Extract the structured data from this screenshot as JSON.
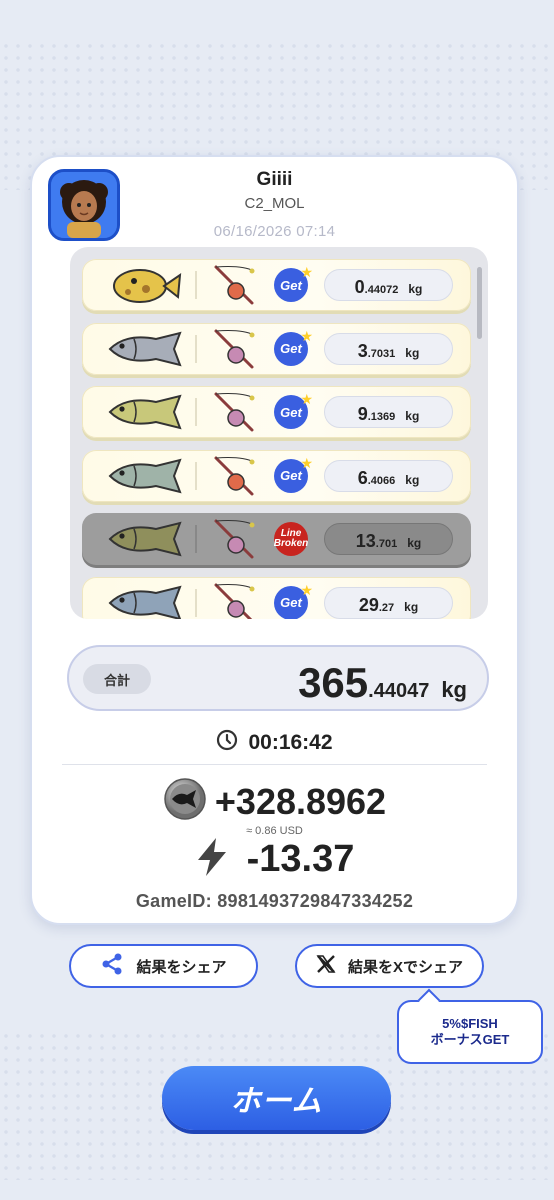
{
  "user": {
    "name": "Giiii",
    "code": "C2_MOL",
    "datetime": "06/16/2026 07:14"
  },
  "catches": [
    {
      "fish": "pufferfish-icon",
      "fish_color": "#e5c34a",
      "rod": "red-rod-icon",
      "status": "Get",
      "int": "0",
      "dec": ".44072",
      "unit": "kg"
    },
    {
      "fish": "grey-fish-icon",
      "fish_color": "#a7adb8",
      "rod": "pink-rod-icon",
      "status": "Get",
      "int": "3",
      "dec": ".7031",
      "unit": "kg"
    },
    {
      "fish": "bass-icon",
      "fish_color": "#c8c87a",
      "rod": "pink-rod-icon",
      "status": "Get",
      "int": "9",
      "dec": ".1369",
      "unit": "kg"
    },
    {
      "fish": "trout-icon",
      "fish_color": "#9fb3a8",
      "rod": "red-rod-icon",
      "status": "Get",
      "int": "6",
      "dec": ".4066",
      "unit": "kg"
    },
    {
      "fish": "bass-icon",
      "fish_color": "#8f8f5c",
      "rod": "pink-rod-icon",
      "status": "Line Broken",
      "int": "13",
      "dec": ".701",
      "unit": "kg"
    },
    {
      "fish": "char-icon",
      "fish_color": "#8fa3b8",
      "rod": "pink-rod-icon",
      "status": "Get",
      "int": "29",
      "dec": ".27",
      "unit": "kg"
    }
  ],
  "total": {
    "label": "合計",
    "int": "365",
    "dec": ".44047",
    "unit": "kg"
  },
  "timer": "00:16:42",
  "reward": {
    "amount": "+328.8962",
    "usd": "≈ 0.86 USD"
  },
  "energy": {
    "amount": "-13.37"
  },
  "game_id": "GameID: 8981493729847334252",
  "buttons": {
    "share": "結果をシェア",
    "share_x": "結果をXでシェア",
    "home": "ホーム"
  },
  "tooltip": {
    "line1": "5%$FISH",
    "line2": "ボーナスGET"
  },
  "colors": {
    "accent": "#3f63e6",
    "badge": "#3a5fe0",
    "broken": "#c8241f"
  }
}
